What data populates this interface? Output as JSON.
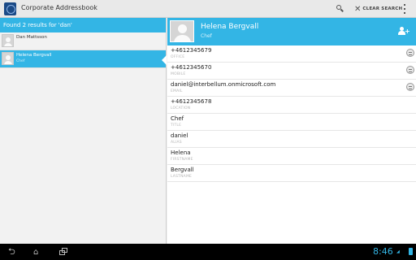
{
  "actionbar": {
    "title": "Corporate Addressbook",
    "icons": [
      "app-icon",
      "search-icon",
      "clear-search-icon",
      "overflow-menu-icon"
    ],
    "clear_search_label": "CLEAR SEARCH"
  },
  "results": {
    "summary": "Found 2 results for 'dan'",
    "items": [
      {
        "name": "Dan Mattsson",
        "subtitle": ""
      },
      {
        "name": "Helena Bergvall",
        "subtitle": "Chef"
      }
    ]
  },
  "detail": {
    "name": "Helena Bergvall",
    "title": "Chef",
    "fields": [
      {
        "value": "+4612345679",
        "label": "OFFICE"
      },
      {
        "value": "+4612345670",
        "label": "MOBILE"
      },
      {
        "value": "daniel@interbellum.onmicrosoft.com",
        "label": "EMAIL"
      },
      {
        "value": "+4612345678",
        "label": "LOCATION"
      },
      {
        "value": "Chef",
        "label": "TITLE"
      },
      {
        "value": "daniel",
        "label": "ALIAS"
      },
      {
        "value": "Helena",
        "label": "FIRSTNAME"
      },
      {
        "value": "Bergvall",
        "label": "LASTNAME"
      }
    ]
  },
  "systembar": {
    "time": "8:46",
    "nav_icons": [
      "back-icon",
      "home-icon",
      "recent-apps-icon"
    ],
    "status_icons": [
      "wifi-icon",
      "battery-icon"
    ]
  },
  "colors": {
    "accent": "#33b5e5",
    "actionbar_bg": "#e9e9e9",
    "systembar_bg": "#000000"
  }
}
